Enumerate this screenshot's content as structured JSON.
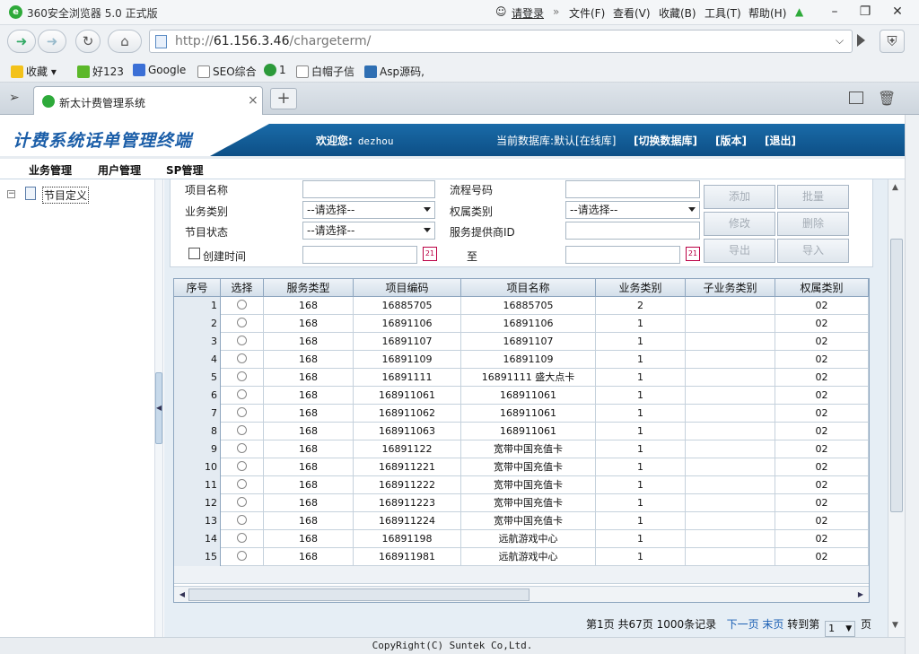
{
  "browser": {
    "title": "360安全浏览器 5.0 正式版",
    "login": "请登录",
    "menus": [
      "文件(F)",
      "查看(V)",
      "收藏(B)",
      "工具(T)",
      "帮助(H)"
    ],
    "url_prefix": "http://",
    "url_host": "61.156.3.46",
    "url_path": "/chargeterm/",
    "bookmarks": [
      "收藏",
      "好123",
      "Google",
      "SEO综合",
      "1",
      "白帽子信",
      "Asp源码,"
    ],
    "tab_title": "新太计费管理系统",
    "tab_close": "×",
    "new_tab": "+"
  },
  "header": {
    "logo": "计费系统话单管理终端",
    "welcome_label": "欢迎您:",
    "username": "dezhou",
    "db_text": "当前数据库:默认[在线库]",
    "links": [
      "[切换数据库]",
      "[版本]",
      "[退出]"
    ]
  },
  "menu": [
    "业务管理",
    "用户管理",
    "SP管理"
  ],
  "sidebar": {
    "toggle": "−",
    "item": "节目定义"
  },
  "form": {
    "labels": {
      "item_name": "项目名称",
      "flow_no": "流程号码",
      "biz_type": "业务类别",
      "rights_type": "权属类别",
      "prog_state": "节目状态",
      "sp_id": "服务提供商ID",
      "create_time": "创建时间",
      "to": "至"
    },
    "select_placeholder": "--请选择--",
    "buttons": [
      "添加",
      "批量",
      "修改",
      "删除",
      "导出",
      "导入"
    ]
  },
  "grid": {
    "columns": [
      "序号",
      "选择",
      "服务类型",
      "项目编码",
      "项目名称",
      "业务类别",
      "子业务类别",
      "权属类别"
    ],
    "rows": [
      {
        "seq": "1",
        "svc": "168",
        "code": "16885705",
        "name": "16885705",
        "biz": "2",
        "sub": "",
        "rights": "02"
      },
      {
        "seq": "2",
        "svc": "168",
        "code": "16891106",
        "name": "16891106",
        "biz": "1",
        "sub": "",
        "rights": "02"
      },
      {
        "seq": "3",
        "svc": "168",
        "code": "16891107",
        "name": "16891107",
        "biz": "1",
        "sub": "",
        "rights": "02"
      },
      {
        "seq": "4",
        "svc": "168",
        "code": "16891109",
        "name": "16891109",
        "biz": "1",
        "sub": "",
        "rights": "02"
      },
      {
        "seq": "5",
        "svc": "168",
        "code": "16891111",
        "name": "16891111 盛大点卡",
        "biz": "1",
        "sub": "",
        "rights": "02"
      },
      {
        "seq": "6",
        "svc": "168",
        "code": "168911061",
        "name": "168911061",
        "biz": "1",
        "sub": "",
        "rights": "02"
      },
      {
        "seq": "7",
        "svc": "168",
        "code": "168911062",
        "name": "168911061",
        "biz": "1",
        "sub": "",
        "rights": "02"
      },
      {
        "seq": "8",
        "svc": "168",
        "code": "168911063",
        "name": "168911061",
        "biz": "1",
        "sub": "",
        "rights": "02"
      },
      {
        "seq": "9",
        "svc": "168",
        "code": "16891122",
        "name": "宽带中国充值卡",
        "biz": "1",
        "sub": "",
        "rights": "02"
      },
      {
        "seq": "10",
        "svc": "168",
        "code": "168911221",
        "name": "宽带中国充值卡",
        "biz": "1",
        "sub": "",
        "rights": "02"
      },
      {
        "seq": "11",
        "svc": "168",
        "code": "168911222",
        "name": "宽带中国充值卡",
        "biz": "1",
        "sub": "",
        "rights": "02"
      },
      {
        "seq": "12",
        "svc": "168",
        "code": "168911223",
        "name": "宽带中国充值卡",
        "biz": "1",
        "sub": "",
        "rights": "02"
      },
      {
        "seq": "13",
        "svc": "168",
        "code": "168911224",
        "name": "宽带中国充值卡",
        "biz": "1",
        "sub": "",
        "rights": "02"
      },
      {
        "seq": "14",
        "svc": "168",
        "code": "16891198",
        "name": "远航游戏中心",
        "biz": "1",
        "sub": "",
        "rights": "02"
      },
      {
        "seq": "15",
        "svc": "168",
        "code": "168911981",
        "name": "远航游戏中心",
        "biz": "1",
        "sub": "",
        "rights": "02"
      }
    ]
  },
  "pager": {
    "page": "第1页",
    "total_pages": "共67页",
    "records": "1000条记录",
    "next": "下一页",
    "last": "末页",
    "goto": "转到第",
    "goto_value": "1",
    "page_suffix": "页"
  },
  "footer": "CopyRight(C) Suntek Co,Ltd."
}
